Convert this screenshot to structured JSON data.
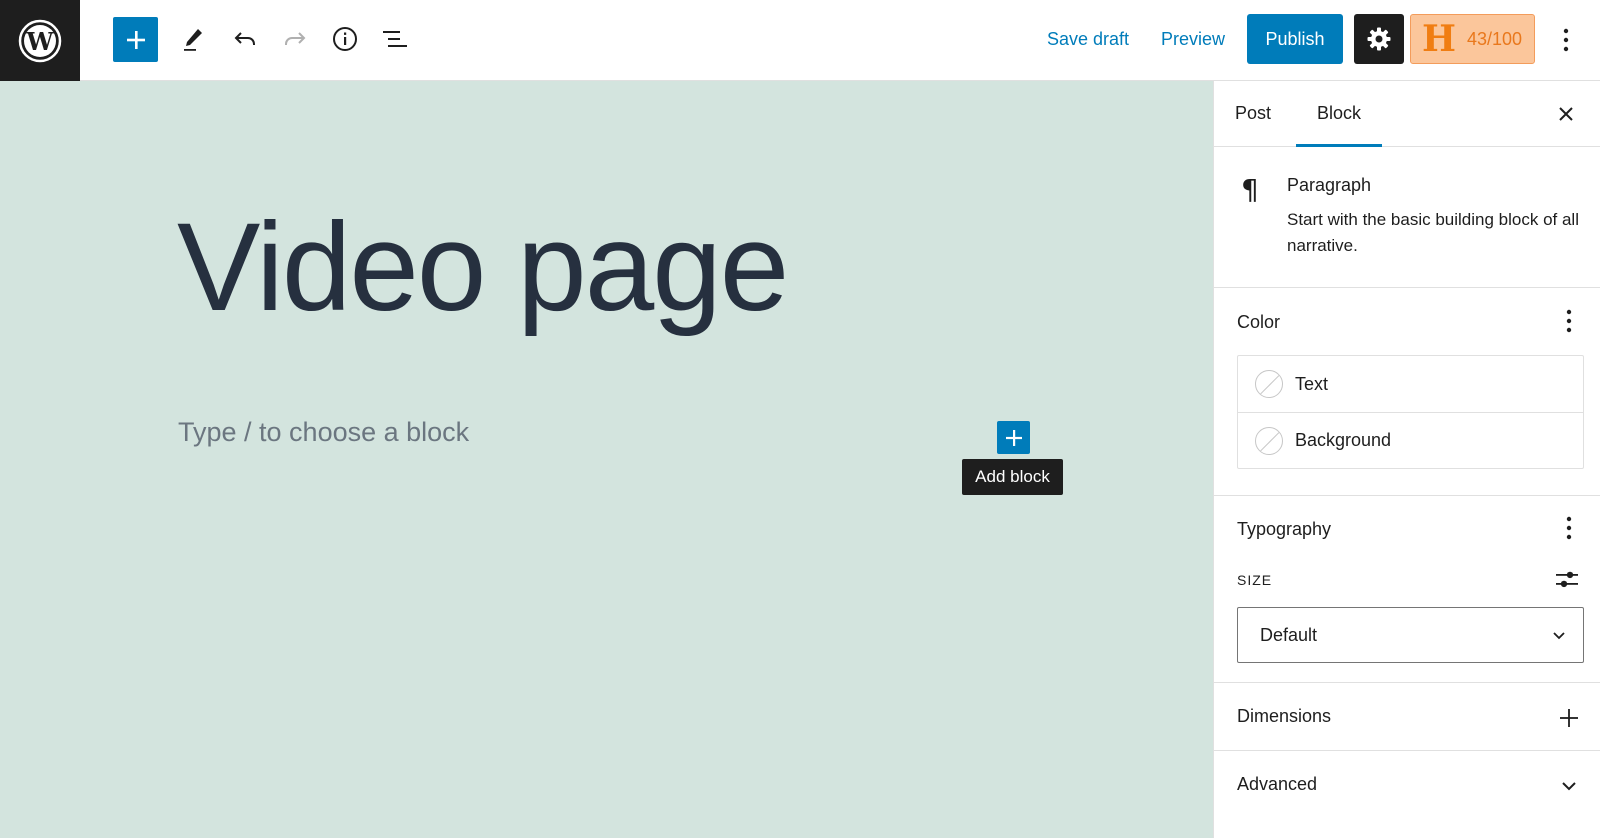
{
  "toolbar": {
    "save_draft_label": "Save draft",
    "preview_label": "Preview",
    "publish_label": "Publish",
    "score_label": "43/100",
    "score_letter": "H",
    "accent_color": "#007cba"
  },
  "editor": {
    "title": "Video page",
    "placeholder": "Type / to choose a block",
    "add_block_tooltip": "Add block",
    "background_color": "#d3e4de"
  },
  "sidebar": {
    "tabs": [
      {
        "label": "Post",
        "active": false
      },
      {
        "label": "Block",
        "active": true
      }
    ],
    "block": {
      "name": "Paragraph",
      "description": "Start with the basic building block of all narrative."
    },
    "color": {
      "title": "Color",
      "items": [
        {
          "label": "Text"
        },
        {
          "label": "Background"
        }
      ]
    },
    "typography": {
      "title": "Typography",
      "size_label": "SIZE",
      "size_value": "Default"
    },
    "dimensions": {
      "title": "Dimensions"
    },
    "advanced": {
      "title": "Advanced"
    }
  }
}
